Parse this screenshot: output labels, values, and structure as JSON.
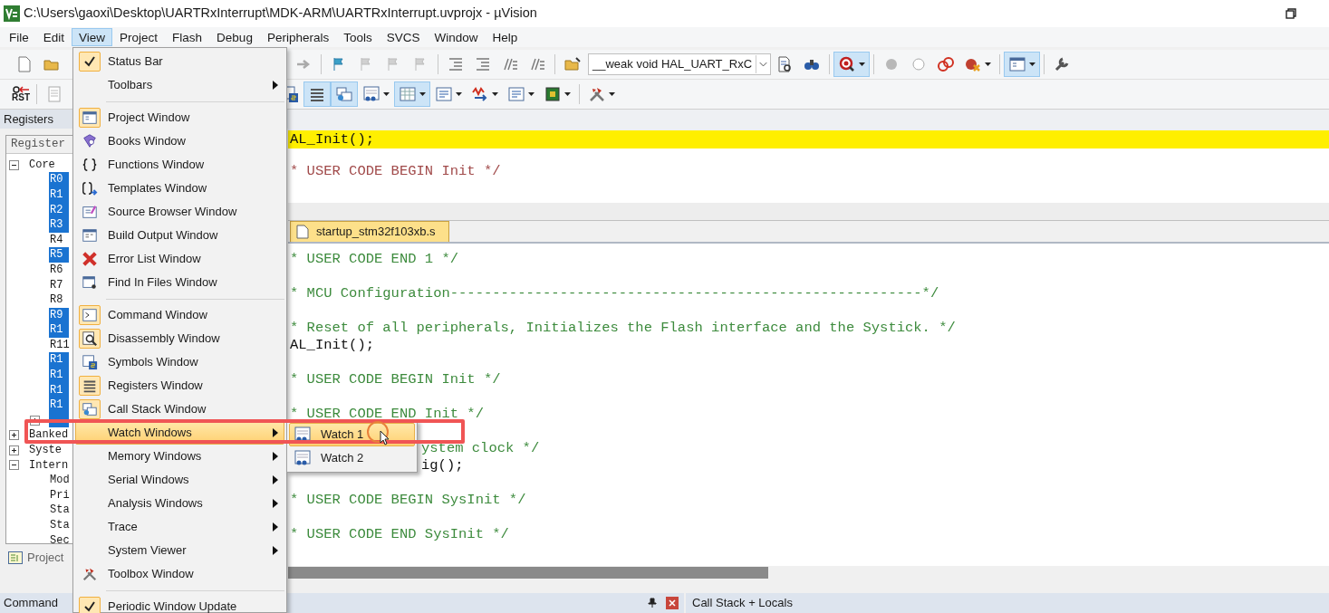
{
  "window": {
    "title": "C:\\Users\\gaoxi\\Desktop\\UARTRxInterrupt\\MDK-ARM\\UARTRxInterrupt.uvprojx - µVision"
  },
  "menu_bar": [
    {
      "label": "File",
      "selected": false
    },
    {
      "label": "Edit",
      "selected": false
    },
    {
      "label": "View",
      "selected": true
    },
    {
      "label": "Project",
      "selected": false
    },
    {
      "label": "Flash",
      "selected": false
    },
    {
      "label": "Debug",
      "selected": false
    },
    {
      "label": "Peripherals",
      "selected": false
    },
    {
      "label": "Tools",
      "selected": false
    },
    {
      "label": "SVCS",
      "selected": false
    },
    {
      "label": "Window",
      "selected": false
    },
    {
      "label": "Help",
      "selected": false
    }
  ],
  "toolbar_1": {
    "function_combo": "__weak void HAL_UART_RxC"
  },
  "toolbar_2": {
    "reset_label": "RST"
  },
  "registers_panel": {
    "title": "Registers",
    "column": "Register",
    "tree": [
      {
        "label": "Core",
        "expanded": true,
        "selected": false,
        "children": [
          {
            "label": "R0",
            "selected": true
          },
          {
            "label": "R1",
            "selected": true
          },
          {
            "label": "R2",
            "selected": true
          },
          {
            "label": "R3",
            "selected": true
          },
          {
            "label": "R4",
            "selected": false
          },
          {
            "label": "R5",
            "selected": true
          },
          {
            "label": "R6",
            "selected": false
          },
          {
            "label": "R7",
            "selected": false
          },
          {
            "label": "R8",
            "selected": false
          },
          {
            "label": "R9",
            "selected": true
          },
          {
            "label": "R1",
            "selected": true
          },
          {
            "label": "R11",
            "selected": false
          },
          {
            "label": "R1",
            "selected": true
          },
          {
            "label": "R1",
            "selected": true
          },
          {
            "label": "R1",
            "selected": true
          },
          {
            "label": "R1",
            "selected": true
          },
          {
            "expanded": false,
            "selected": true
          }
        ]
      },
      {
        "label": "Banked",
        "expanded": false,
        "selected": false
      },
      {
        "label": "Syste",
        "expanded": false,
        "selected": false
      },
      {
        "label": "Intern",
        "expanded": true,
        "selected": false,
        "children": [
          {
            "label": "Mod",
            "selected": false
          },
          {
            "label": "Pri",
            "selected": false
          },
          {
            "label": "Sta",
            "selected": false
          },
          {
            "label": "Sta",
            "selected": false
          },
          {
            "label": "Sec",
            "selected": false
          }
        ]
      }
    ]
  },
  "project_tab": {
    "label": "Project"
  },
  "editor": {
    "top_lines": [
      {
        "kind": "code",
        "text": "AL_Init();",
        "highlighted": true
      },
      {
        "kind": "blank"
      },
      {
        "kind": "comment",
        "text": "* USER CODE BEGIN Init */",
        "highlighted": false
      }
    ],
    "tabs": [
      {
        "label": "startup_stm32f103xb.s",
        "selected": true
      }
    ],
    "lines": [
      {
        "kind": "comment",
        "text": "* USER CODE END 1 */"
      },
      {
        "kind": "blank"
      },
      {
        "kind": "comment",
        "text": "* MCU Configuration--------------------------------------------------------*/"
      },
      {
        "kind": "blank"
      },
      {
        "kind": "comment",
        "text": "* Reset of all peripherals, Initializes the Flash interface and the Systick. */"
      },
      {
        "kind": "code",
        "text": "AL_Init();"
      },
      {
        "kind": "blank"
      },
      {
        "kind": "comment",
        "text": "* USER CODE BEGIN Init */"
      },
      {
        "kind": "blank"
      },
      {
        "kind": "comment",
        "text": "* USER CODE END Init */"
      },
      {
        "kind": "blank"
      },
      {
        "kind": "comment",
        "text": "ystem clock */",
        "partly_hidden": true
      },
      {
        "kind": "code",
        "text": "ig();",
        "partly_hidden": true
      },
      {
        "kind": "blank"
      },
      {
        "kind": "comment",
        "text": "* USER CODE BEGIN SysInit */"
      },
      {
        "kind": "blank"
      },
      {
        "kind": "comment",
        "text": "* USER CODE END SysInit */"
      }
    ]
  },
  "bottom": {
    "command_title": "Command",
    "call_stack_title": "Call Stack + Locals"
  },
  "view_menu": [
    {
      "kind": "check",
      "label": "Status Bar",
      "checked": true,
      "selected": false
    },
    {
      "kind": "submenu",
      "label": "Toolbars",
      "selected": false
    },
    {
      "kind": "separator"
    },
    {
      "kind": "window",
      "label": "Project Window",
      "checked": true,
      "selected": false
    },
    {
      "kind": "window",
      "label": "Books Window",
      "checked": false,
      "selected": false
    },
    {
      "kind": "window",
      "label": "Functions Window",
      "checked": false,
      "selected": false
    },
    {
      "kind": "window",
      "label": "Templates Window",
      "checked": false,
      "selected": false
    },
    {
      "kind": "window",
      "label": "Source Browser Window",
      "checked": false,
      "selected": false
    },
    {
      "kind": "window",
      "label": "Build Output Window",
      "checked": false,
      "selected": false
    },
    {
      "kind": "window",
      "label": "Error List Window",
      "checked": false,
      "selected": false
    },
    {
      "kind": "window",
      "label": "Find In Files Window",
      "checked": false,
      "selected": false
    },
    {
      "kind": "separator"
    },
    {
      "kind": "window",
      "label": "Command Window",
      "checked": true,
      "selected": false
    },
    {
      "kind": "window",
      "label": "Disassembly Window",
      "checked": true,
      "selected": false
    },
    {
      "kind": "window",
      "label": "Symbols Window",
      "checked": false,
      "selected": false
    },
    {
      "kind": "window",
      "label": "Registers Window",
      "checked": true,
      "selected": false
    },
    {
      "kind": "window",
      "label": "Call Stack Window",
      "checked": true,
      "selected": false
    },
    {
      "kind": "submenu",
      "label": "Watch Windows",
      "selected": true
    },
    {
      "kind": "submenu",
      "label": "Memory Windows",
      "selected": false
    },
    {
      "kind": "submenu",
      "label": "Serial Windows",
      "selected": false
    },
    {
      "kind": "submenu",
      "label": "Analysis Windows",
      "selected": false
    },
    {
      "kind": "submenu",
      "label": "Trace",
      "selected": false
    },
    {
      "kind": "submenu",
      "label": "System Viewer",
      "selected": false
    },
    {
      "kind": "window",
      "label": "Toolbox Window",
      "checked": false,
      "selected": false
    },
    {
      "kind": "separator"
    },
    {
      "kind": "check",
      "label": "Periodic Window Update",
      "checked": true,
      "selected": false
    }
  ],
  "watch_submenu": [
    {
      "label": "Watch 1",
      "selected": true
    },
    {
      "label": "Watch 2",
      "selected": false
    }
  ]
}
